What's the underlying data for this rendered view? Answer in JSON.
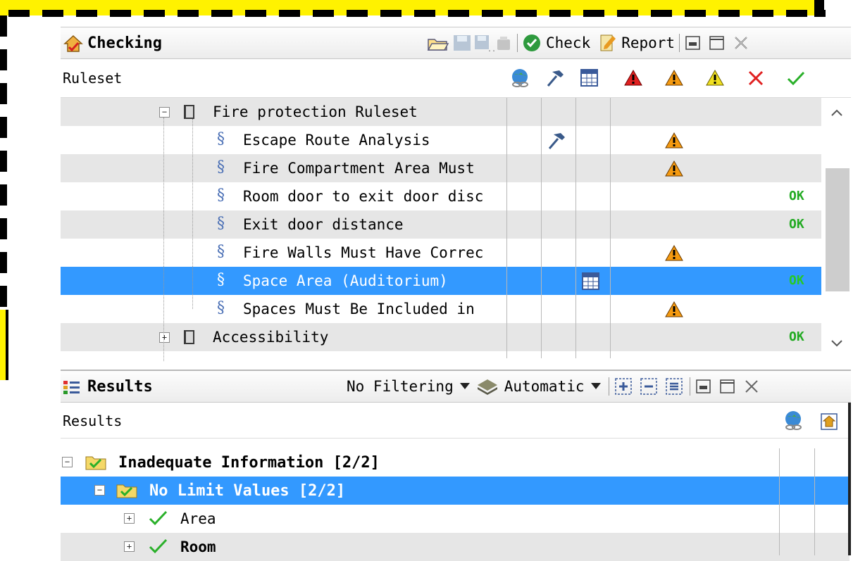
{
  "checking": {
    "title": "Checking",
    "toolbar": {
      "check_label": "Check",
      "report_label": "Report"
    },
    "ruleset_header": "Ruleset",
    "rows": [
      {
        "label": "Fire protection Ruleset",
        "type": "group",
        "status": ""
      },
      {
        "label": "Escape Route Analysis",
        "type": "rule",
        "hammer": true,
        "status": "warn"
      },
      {
        "label": "Fire Compartment Area Must",
        "type": "rule",
        "status": "warn"
      },
      {
        "label": "Room door to exit door disc",
        "type": "rule",
        "status": "OK"
      },
      {
        "label": "Exit door distance",
        "type": "rule",
        "status": "OK"
      },
      {
        "label": "Fire Walls Must Have Correc",
        "type": "rule",
        "status": "warn"
      },
      {
        "label": "Space Area (Auditorium)",
        "type": "rule",
        "table": true,
        "status": "OK",
        "selected": true
      },
      {
        "label": "Spaces Must Be Included in",
        "type": "rule",
        "status": "warn"
      },
      {
        "label": "Accessibility",
        "type": "group",
        "status": "OK"
      }
    ]
  },
  "results": {
    "title": "Results",
    "filter_label": "No Filtering",
    "auto_label": "Automatic",
    "header": "Results",
    "rows": [
      {
        "label": "Inadequate Information [2/2]"
      },
      {
        "label": "No Limit Values [2/2]"
      },
      {
        "label": "Area"
      },
      {
        "label": "Room"
      }
    ]
  }
}
